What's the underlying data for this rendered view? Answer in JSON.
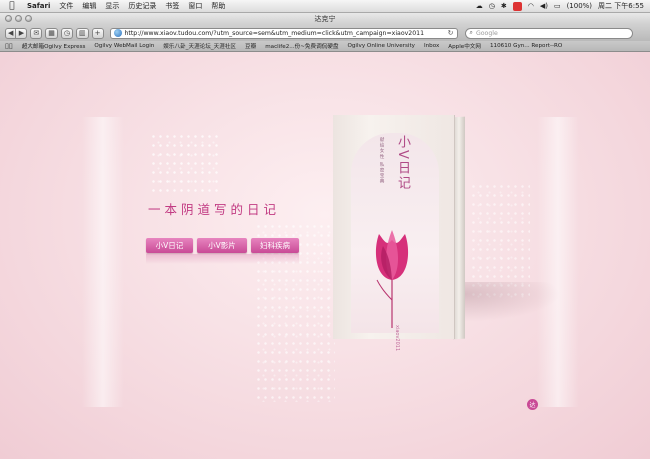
{
  "menubar": {
    "app": "Safari",
    "items": [
      "文件",
      "编辑",
      "显示",
      "历史记录",
      "书签",
      "窗口",
      "帮助"
    ],
    "battery": "(100%)",
    "clock": "周二 下午6:55"
  },
  "window": {
    "title": "达克宁"
  },
  "toolbar": {
    "url": "http://www.xiaov.tudou.com/?utm_source=sem&utm_medium=click&utm_campaign=xiaov2011",
    "search_placeholder": "Google",
    "add_label": "+"
  },
  "bookmarks": [
    "超大邮箱Ogilvy Express",
    "Ogilvy WebMail Login",
    "娱乐八卦_天涯论坛_天涯社区",
    "豆瓣",
    "maclife2...份~免费调侃硬盘",
    "Ogilvy Online University",
    "Inbox",
    "Apple中文网",
    "110610 Gyn... Report--RO"
  ],
  "page": {
    "headline": "一本阴道写的日记",
    "buttons": [
      "小V日记",
      "小V影片",
      "妇科疾病"
    ],
    "book": {
      "title": "小V日记",
      "subtitle_line1": "献给女性",
      "subtitle_line2": "私密宝典",
      "author": "xiaov2011"
    },
    "corner_badge": "达"
  },
  "colors": {
    "accent": "#c94a96",
    "headline": "#c23b83",
    "page_bg": "#f7dde2"
  }
}
